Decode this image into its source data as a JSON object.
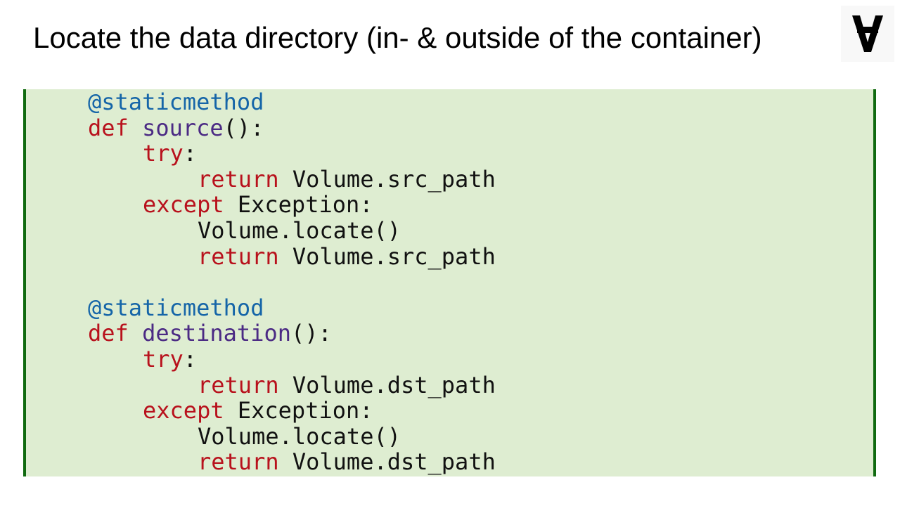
{
  "slide": {
    "title": "Locate the data directory (in- & outside of the container)"
  },
  "logo": {
    "icon": "for-all-symbol-icon",
    "color": "#000000"
  },
  "code_panel": {
    "background": "#deedd1",
    "border_color": "#106a10",
    "language": "python"
  },
  "code": {
    "decorator_1": "@staticmethod",
    "kw_def_1": "def",
    "func_1": "source",
    "paren_1": "():",
    "kw_try_1": "try",
    "colon_try_1": ":",
    "kw_return_1": "return",
    "ret_expr_1": "Volume.src_path",
    "kw_except_1": "except",
    "except_expr_1": "Exception:",
    "call_1": "Volume.locate()",
    "kw_return_2": "return",
    "ret_expr_2": "Volume.src_path",
    "decorator_2": "@staticmethod",
    "kw_def_2": "def",
    "func_2": "destination",
    "paren_2": "():",
    "kw_try_2": "try",
    "colon_try_2": ":",
    "kw_return_3": "return",
    "ret_expr_3": "Volume.dst_path",
    "kw_except_2": "except",
    "except_expr_2": "Exception:",
    "call_2": "Volume.locate()",
    "kw_return_4": "return",
    "ret_expr_4": "Volume.dst_path"
  }
}
